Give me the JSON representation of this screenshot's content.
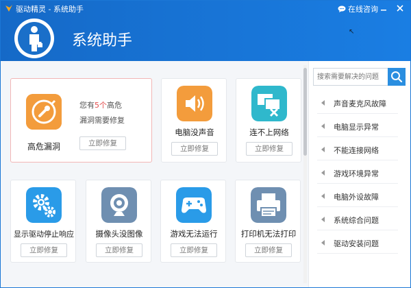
{
  "titlebar": {
    "app_title": "驱动精灵 - 系统助手",
    "consult_label": "在线咨询"
  },
  "header": {
    "title": "系统助手"
  },
  "highlight_card": {
    "label": "高危漏洞",
    "warn_prefix": "您有",
    "warn_count": "5个",
    "warn_suffix": "高危",
    "warn_line2": "漏洞需要修复",
    "button": "立即修复"
  },
  "cards": [
    {
      "label": "电脑没声音",
      "button": "立即修复",
      "icon": "speaker-icon"
    },
    {
      "label": "连不上网络",
      "button": "立即修复",
      "icon": "network-icon"
    },
    {
      "label": "显示驱动停止响应",
      "button": "立即修复",
      "icon": "gear-icon"
    },
    {
      "label": "摄像头没图像",
      "button": "立即修复",
      "icon": "webcam-icon"
    },
    {
      "label": "游戏无法运行",
      "button": "立即修复",
      "icon": "gamepad-icon"
    },
    {
      "label": "打印机无法打印",
      "button": "立即修复",
      "icon": "printer-icon"
    }
  ],
  "search": {
    "placeholder": "搜索需要解决的问题"
  },
  "side_items": [
    "声音麦克风故障",
    "电脑显示异常",
    "不能连接网络",
    "游戏环境异常",
    "电脑外设故障",
    "系统综合问题",
    "驱动安装问题"
  ],
  "colors": {
    "header_blue": "#1a7ee3",
    "accent_orange": "#f39c3c",
    "warn_red": "#e34b4b"
  }
}
